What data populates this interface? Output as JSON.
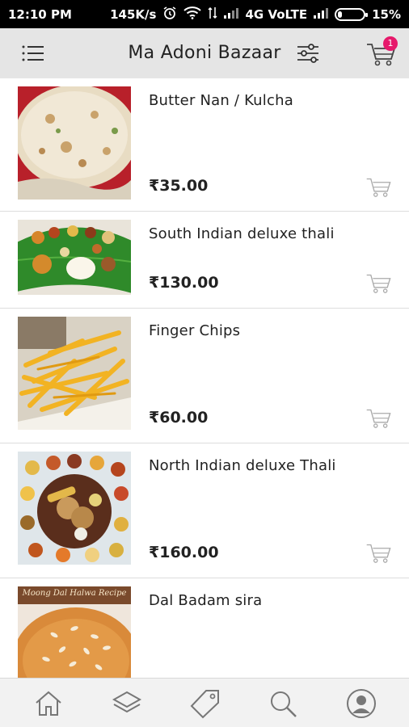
{
  "status_bar": {
    "time": "12:10 PM",
    "speed": "145K/s",
    "network": "4G VoLTE",
    "battery": "15%",
    "battery_level": 0.15
  },
  "app_bar": {
    "title": "Ma Adoni Bazaar",
    "cart_count": "1",
    "icons": [
      "menu-icon",
      "filter-icon",
      "cart-icon"
    ]
  },
  "products": [
    {
      "name": "Butter Nan / Kulcha",
      "price": "₹35.00",
      "image": "butter-nan-photo"
    },
    {
      "name": "South Indian deluxe thali",
      "price": "₹130.00",
      "image": "south-indian-thali-photo"
    },
    {
      "name": "Finger Chips",
      "price": "₹60.00",
      "image": "finger-chips-photo"
    },
    {
      "name": "North Indian deluxe Thali",
      "price": "₹160.00",
      "image": "north-indian-thali-photo"
    },
    {
      "name": "Dal Badam sira",
      "price": "",
      "image": "dal-badam-sira-photo",
      "image_caption": "Moong Dal Halwa Recipe"
    }
  ],
  "bottom_nav": {
    "items": [
      "home-icon",
      "layers-icon",
      "tag-icon",
      "search-icon",
      "profile-icon"
    ]
  },
  "colors": {
    "app_bar_bg": "#e5e5e5",
    "badge": "#e6196b",
    "divider": "#dddddd",
    "bottom_nav_bg": "#f2f2f2"
  }
}
